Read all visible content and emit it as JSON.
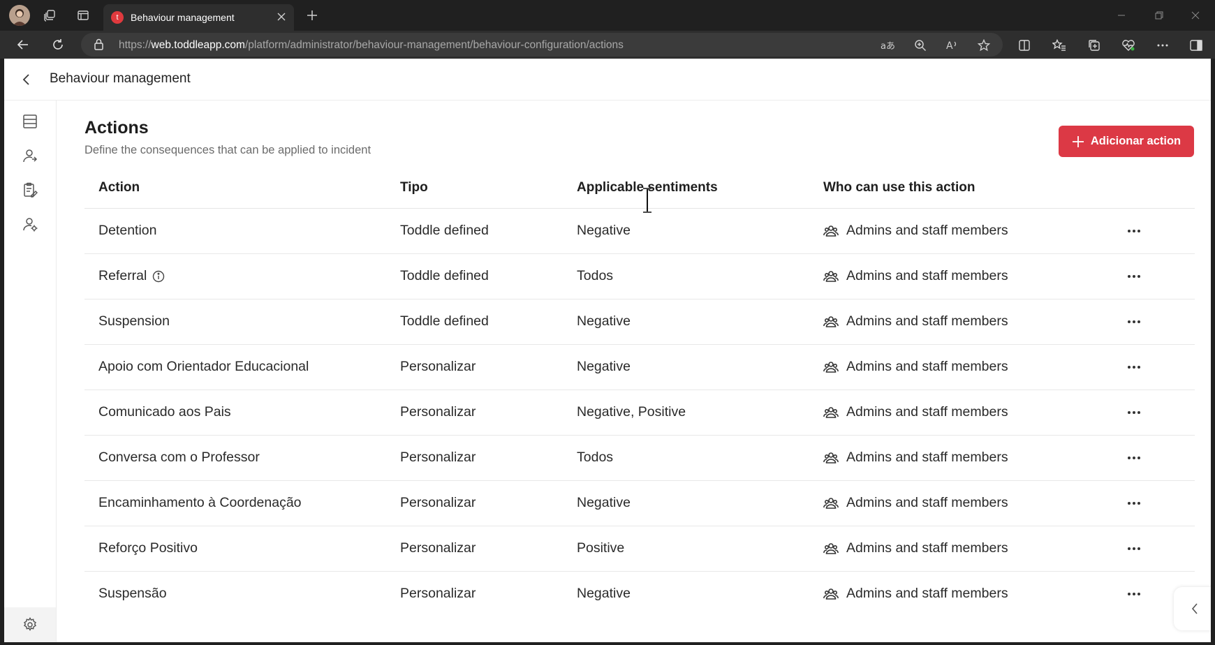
{
  "browser": {
    "tab_title": "Behaviour management",
    "tab_favicon_letter": "t",
    "url_prefix": "https://",
    "url_host": "web.toddleapp.com",
    "url_path": "/platform/administrator/behaviour-management/behaviour-configuration/actions"
  },
  "app": {
    "header_title": "Behaviour management"
  },
  "page": {
    "title": "Actions",
    "subtitle": "Define the consequences that can be applied to incident",
    "add_button_label": "Adicionar action"
  },
  "table": {
    "columns": [
      "Action",
      "Tipo",
      "Applicable sentiments",
      "Who can use this action"
    ],
    "rows": [
      {
        "action": "Detention",
        "tipo": "Toddle defined",
        "sentiments": "Negative",
        "who": "Admins and staff members",
        "info": false
      },
      {
        "action": "Referral",
        "tipo": "Toddle defined",
        "sentiments": "Todos",
        "who": "Admins and staff members",
        "info": true
      },
      {
        "action": "Suspension",
        "tipo": "Toddle defined",
        "sentiments": "Negative",
        "who": "Admins and staff members",
        "info": false
      },
      {
        "action": "Apoio com Orientador Educacional",
        "tipo": "Personalizar",
        "sentiments": "Negative",
        "who": "Admins and staff members",
        "info": false
      },
      {
        "action": "Comunicado aos Pais",
        "tipo": "Personalizar",
        "sentiments": "Negative, Positive",
        "who": "Admins and staff members",
        "info": false
      },
      {
        "action": "Conversa com o Professor",
        "tipo": "Personalizar",
        "sentiments": "Todos",
        "who": "Admins and staff members",
        "info": false
      },
      {
        "action": "Encaminhamento à Coordenação",
        "tipo": "Personalizar",
        "sentiments": "Negative",
        "who": "Admins and staff members",
        "info": false
      },
      {
        "action": "Reforço Positivo",
        "tipo": "Personalizar",
        "sentiments": "Positive",
        "who": "Admins and staff members",
        "info": false
      },
      {
        "action": "Suspensão",
        "tipo": "Personalizar",
        "sentiments": "Negative",
        "who": "Admins and staff members",
        "info": false
      }
    ]
  },
  "colors": {
    "accent": "#dc3945",
    "chrome_dark": "#202020",
    "chrome_toolbar": "#2e2e2e"
  }
}
